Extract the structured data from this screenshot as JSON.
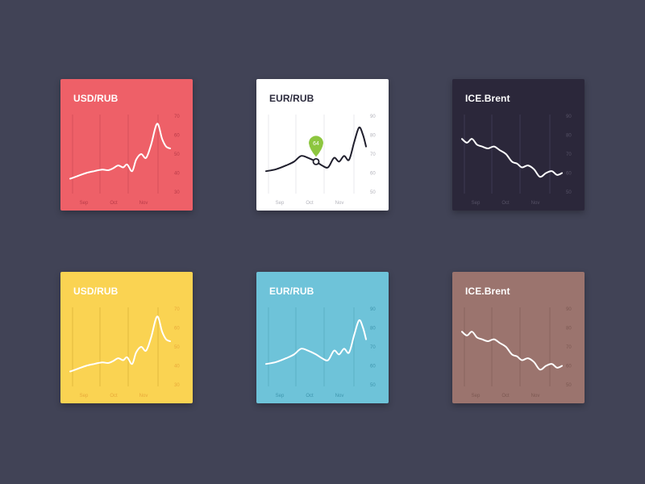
{
  "chart_data": [
    {
      "type": "line",
      "title": "USD/RUB",
      "theme": {
        "bg": "#ee6068",
        "title": "#ffffff",
        "line": "#ffffff",
        "tick": "#b83b48",
        "grid": "#d9525d"
      },
      "x_ticks": [
        "Sep",
        "Oct",
        "Nov"
      ],
      "y_ticks": [
        70,
        60,
        50,
        40,
        30
      ],
      "ylim": [
        30,
        70
      ],
      "series": [
        {
          "x": [
            0,
            0.08,
            0.16,
            0.24,
            0.32,
            0.38,
            0.43,
            0.48,
            0.53,
            0.57,
            0.62,
            0.66,
            0.71,
            0.76,
            0.81,
            0.87,
            0.92,
            0.96,
            1.0
          ],
          "values": [
            37,
            38.5,
            40,
            41,
            41.8,
            41.5,
            42.5,
            44,
            43,
            44.5,
            41,
            47,
            50,
            48,
            55,
            66,
            58,
            54,
            53
          ]
        }
      ]
    },
    {
      "type": "line",
      "title": "EUR/RUB",
      "theme": {
        "bg": "#ffffff",
        "title": "#2c2b3d",
        "line": "#1f1e2c",
        "tick": "#b3b3bb",
        "grid": "#ececef"
      },
      "x_ticks": [
        "Sep",
        "Oct",
        "Nov"
      ],
      "y_ticks": [
        90,
        80,
        70,
        60,
        50
      ],
      "ylim": [
        50,
        90
      ],
      "series": [
        {
          "x": [
            0,
            0.1,
            0.2,
            0.28,
            0.35,
            0.42,
            0.5,
            0.56,
            0.62,
            0.68,
            0.73,
            0.78,
            0.83,
            0.88,
            0.93,
            0.97,
            1.0
          ],
          "values": [
            61,
            62,
            64,
            66,
            69,
            68,
            66,
            64,
            63,
            68,
            66,
            69,
            67,
            76,
            84,
            80,
            74
          ]
        }
      ],
      "annotation": {
        "label": "64",
        "x": 0.5,
        "value": 66,
        "color": "#8dc63f"
      }
    },
    {
      "type": "line",
      "title": "ICE.Brent",
      "theme": {
        "bg": "#2b273a",
        "title": "#ffffff",
        "line": "#ffffff",
        "tick": "#565266",
        "grid": "#3a3650"
      },
      "x_ticks": [
        "Sep",
        "Oct",
        "Nov"
      ],
      "y_ticks": [
        90,
        80,
        70,
        60,
        50
      ],
      "ylim": [
        50,
        90
      ],
      "series": [
        {
          "x": [
            0,
            0.05,
            0.1,
            0.15,
            0.2,
            0.26,
            0.32,
            0.38,
            0.44,
            0.5,
            0.55,
            0.6,
            0.66,
            0.72,
            0.78,
            0.84,
            0.9,
            0.95,
            1.0
          ],
          "values": [
            78,
            76,
            78,
            75,
            74,
            73,
            74,
            72,
            70,
            66,
            65,
            63,
            64,
            62,
            58,
            60,
            61,
            59,
            60
          ]
        }
      ]
    },
    {
      "type": "line",
      "title": "USD/RUB",
      "theme": {
        "bg": "#fad352",
        "title": "#ffffff",
        "line": "#ffffff",
        "tick": "#e8a93a",
        "grid": "#e7bf42"
      },
      "x_ticks": [
        "Sep",
        "Oct",
        "Nov"
      ],
      "y_ticks": [
        70,
        60,
        50,
        40,
        30
      ],
      "ylim": [
        30,
        70
      ],
      "series": [
        {
          "x": [
            0,
            0.08,
            0.16,
            0.24,
            0.32,
            0.38,
            0.43,
            0.48,
            0.53,
            0.57,
            0.62,
            0.66,
            0.71,
            0.76,
            0.81,
            0.87,
            0.92,
            0.96,
            1.0
          ],
          "values": [
            37,
            38.5,
            40,
            41,
            41.8,
            41.5,
            42.5,
            44,
            43,
            44.5,
            41,
            47,
            50,
            48,
            55,
            66,
            58,
            54,
            53
          ]
        }
      ]
    },
    {
      "type": "line",
      "title": "EUR/RUB",
      "theme": {
        "bg": "#6ec3d9",
        "title": "#ffffff",
        "line": "#ffffff",
        "tick": "#3e95ad",
        "grid": "#5fb3c9"
      },
      "x_ticks": [
        "Sep",
        "Oct",
        "Nov"
      ],
      "y_ticks": [
        90,
        80,
        70,
        60,
        50
      ],
      "ylim": [
        50,
        90
      ],
      "series": [
        {
          "x": [
            0,
            0.1,
            0.2,
            0.28,
            0.35,
            0.42,
            0.5,
            0.56,
            0.62,
            0.68,
            0.73,
            0.78,
            0.83,
            0.88,
            0.93,
            0.97,
            1.0
          ],
          "values": [
            61,
            62,
            64,
            66,
            69,
            68,
            66,
            64,
            63,
            68,
            66,
            69,
            67,
            76,
            84,
            80,
            74
          ]
        }
      ]
    },
    {
      "type": "line",
      "title": "ICE.Brent",
      "theme": {
        "bg": "#9b746e",
        "title": "#ffffff",
        "line": "#ffffff",
        "tick": "#7c5852",
        "grid": "#8c6761"
      },
      "x_ticks": [
        "Sep",
        "Oct",
        "Nov"
      ],
      "y_ticks": [
        90,
        80,
        70,
        60,
        50
      ],
      "ylim": [
        50,
        90
      ],
      "series": [
        {
          "x": [
            0,
            0.05,
            0.1,
            0.15,
            0.2,
            0.26,
            0.32,
            0.38,
            0.44,
            0.5,
            0.55,
            0.6,
            0.66,
            0.72,
            0.78,
            0.84,
            0.9,
            0.95,
            1.0
          ],
          "values": [
            78,
            76,
            78,
            75,
            74,
            73,
            74,
            72,
            70,
            66,
            65,
            63,
            64,
            62,
            58,
            60,
            61,
            59,
            60
          ]
        }
      ]
    }
  ]
}
